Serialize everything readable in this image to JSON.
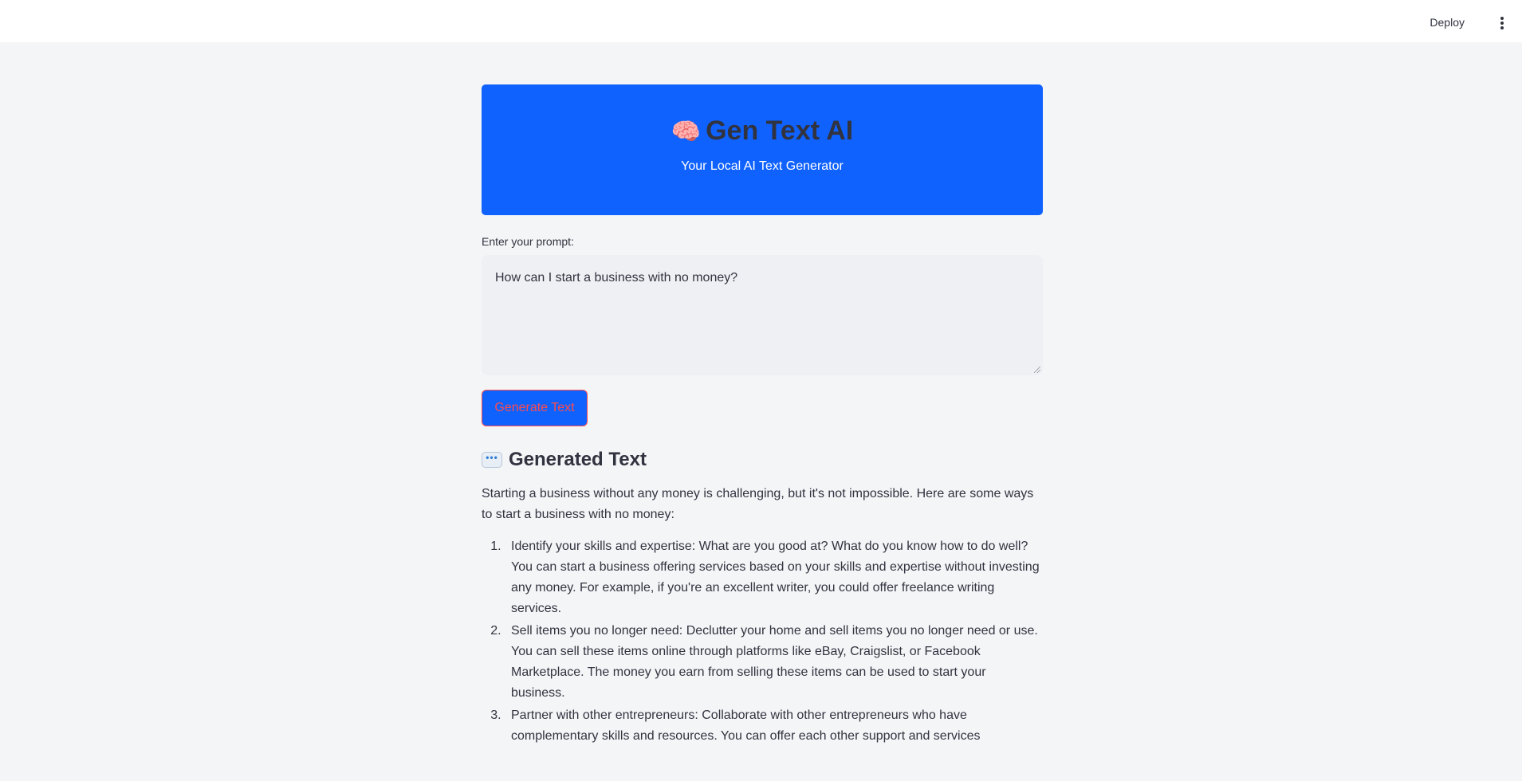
{
  "header": {
    "deploy_label": "Deploy",
    "menu_icon": "vertical-ellipsis-icon"
  },
  "hero": {
    "icon": "brain-icon",
    "icon_glyph": "🧠",
    "title": "Gen Text AI",
    "subtitle": "Your Local AI Text Generator",
    "background_color": "#1062fe"
  },
  "prompt": {
    "label": "Enter your prompt:",
    "value": "How can I start a business with no money?"
  },
  "generate_button": {
    "label": "Generate Text"
  },
  "output": {
    "icon": "speech-bubble-icon",
    "heading": "Generated Text",
    "intro": "Starting a business without any money is challenging, but it's not impossible. Here are some ways to start a business with no money:",
    "items": [
      "Identify your skills and expertise: What are you good at? What do you know how to do well? You can start a business offering services based on your skills and expertise without investing any money. For example, if you're an excellent writer, you could offer freelance writing services.",
      "Sell items you no longer need: Declutter your home and sell items you no longer need or use. You can sell these items online through platforms like eBay, Craigslist, or Facebook Marketplace. The money you earn from selling these items can be used to start your business.",
      "Partner with other entrepreneurs: Collaborate with other entrepreneurs who have complementary skills and resources. You can offer each other support and services"
    ]
  }
}
